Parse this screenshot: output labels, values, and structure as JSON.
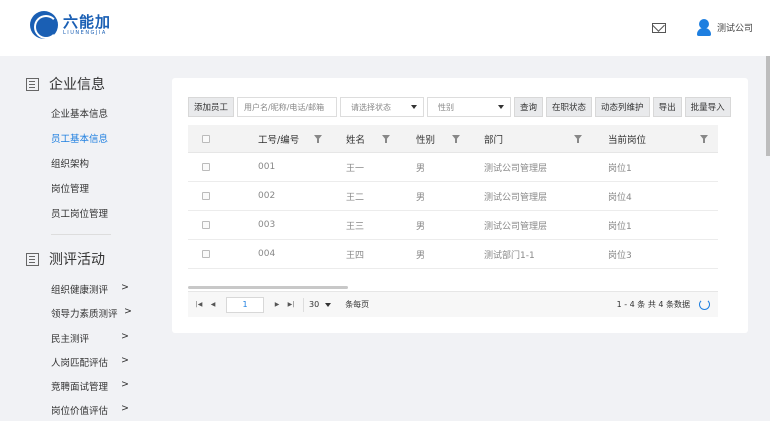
{
  "header": {
    "logo_cn": "六能加",
    "logo_en": "LIUNENGJIA",
    "user_name": "测试公司"
  },
  "sidebar": {
    "section1": {
      "title": "企业信息",
      "items": [
        {
          "label": "企业基本信息"
        },
        {
          "label": "员工基本信息"
        },
        {
          "label": "组织架构"
        },
        {
          "label": "岗位管理"
        },
        {
          "label": "员工岗位管理"
        }
      ]
    },
    "section2": {
      "title": "测评活动",
      "items": [
        {
          "label": "组织健康测评",
          "chev": ">"
        },
        {
          "label": "领导力素质测评",
          "chev": ">"
        },
        {
          "label": "民主测评",
          "chev": ">"
        },
        {
          "label": "人岗匹配评估",
          "chev": ">"
        },
        {
          "label": "竞聘面试管理",
          "chev": ">"
        },
        {
          "label": "岗位价值评估",
          "chev": ">"
        }
      ]
    }
  },
  "toolbar": {
    "add_employee": "添加员工",
    "search_placeholder": "用户名/昵称/电话/邮箱",
    "status_select": "请选择状态",
    "gender_select": "性别",
    "query": "查询",
    "in_service": "在职状态",
    "dynamic_maintain": "动态列维护",
    "export": "导出",
    "bulk_import": "批量导入"
  },
  "table": {
    "columns": {
      "id": "工号/编号",
      "name": "姓名",
      "gender": "性别",
      "department": "部门",
      "position": "当前岗位"
    },
    "rows": [
      {
        "id": "001",
        "name": "王一",
        "gender": "男",
        "department": "测试公司管理层",
        "position": "岗位1"
      },
      {
        "id": "002",
        "name": "王二",
        "gender": "男",
        "department": "测试公司管理层",
        "position": "岗位4"
      },
      {
        "id": "003",
        "name": "王三",
        "gender": "男",
        "department": "测试公司管理层",
        "position": "岗位1"
      },
      {
        "id": "004",
        "name": "王四",
        "gender": "男",
        "department": "测试部门1-1",
        "position": "岗位3"
      }
    ]
  },
  "pager": {
    "first": "|◀",
    "prev": "◀",
    "next": "▶",
    "last": "▶|",
    "page": "1",
    "page_size": "30",
    "per_page_label": "条每页",
    "info": "1 - 4 条   共 4 条数据"
  }
}
